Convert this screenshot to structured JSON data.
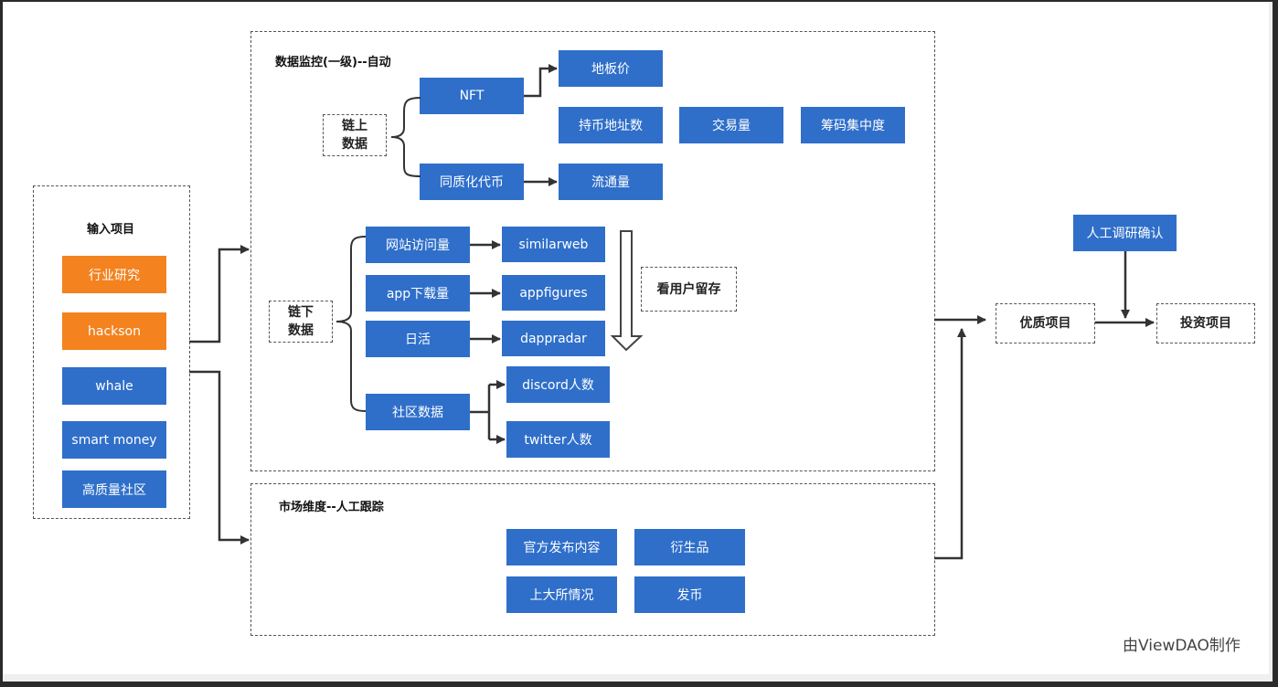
{
  "colors": {
    "primary_box": "#2f6fca",
    "source_box": "#f3821f",
    "connector": "#333333"
  },
  "input_panel": {
    "title": "输入项目",
    "items": [
      {
        "label": "行业研究",
        "color": "orange"
      },
      {
        "label": "hackson",
        "color": "orange"
      },
      {
        "label": "whale",
        "color": "blue"
      },
      {
        "label": "smart money",
        "color": "blue"
      },
      {
        "label": "高质量社区",
        "color": "blue"
      }
    ]
  },
  "monitor_panel": {
    "title": "数据监控(一级)--自动",
    "onchain": {
      "label": "链上\n数据",
      "nft": {
        "label": "NFT",
        "targets": [
          "地板价"
        ]
      },
      "standalone": [
        "持币地址数",
        "交易量",
        "筹码集中度"
      ],
      "fungible": {
        "label": "同质化代币",
        "targets": [
          "流通量"
        ]
      }
    },
    "offchain": {
      "label": "链下\n数据",
      "rows": [
        {
          "label": "网站访问量",
          "tool": "similarweb"
        },
        {
          "label": "app下载量",
          "tool": "appfigures"
        },
        {
          "label": "日活",
          "tool": "dappradar"
        }
      ],
      "community": {
        "label": "社区数据",
        "targets": [
          "discord人数",
          "twitter人数"
        ]
      },
      "retention_note": "看用户留存"
    }
  },
  "market_panel": {
    "title": "市场维度--人工跟踪",
    "items": [
      "官方发布内容",
      "衍生品",
      "上大所情况",
      "发币"
    ]
  },
  "output": {
    "quality_projects": "优质项目",
    "manual_research": "人工调研确认",
    "invest_projects": "投资项目"
  },
  "watermark": "由ViewDAO制作"
}
